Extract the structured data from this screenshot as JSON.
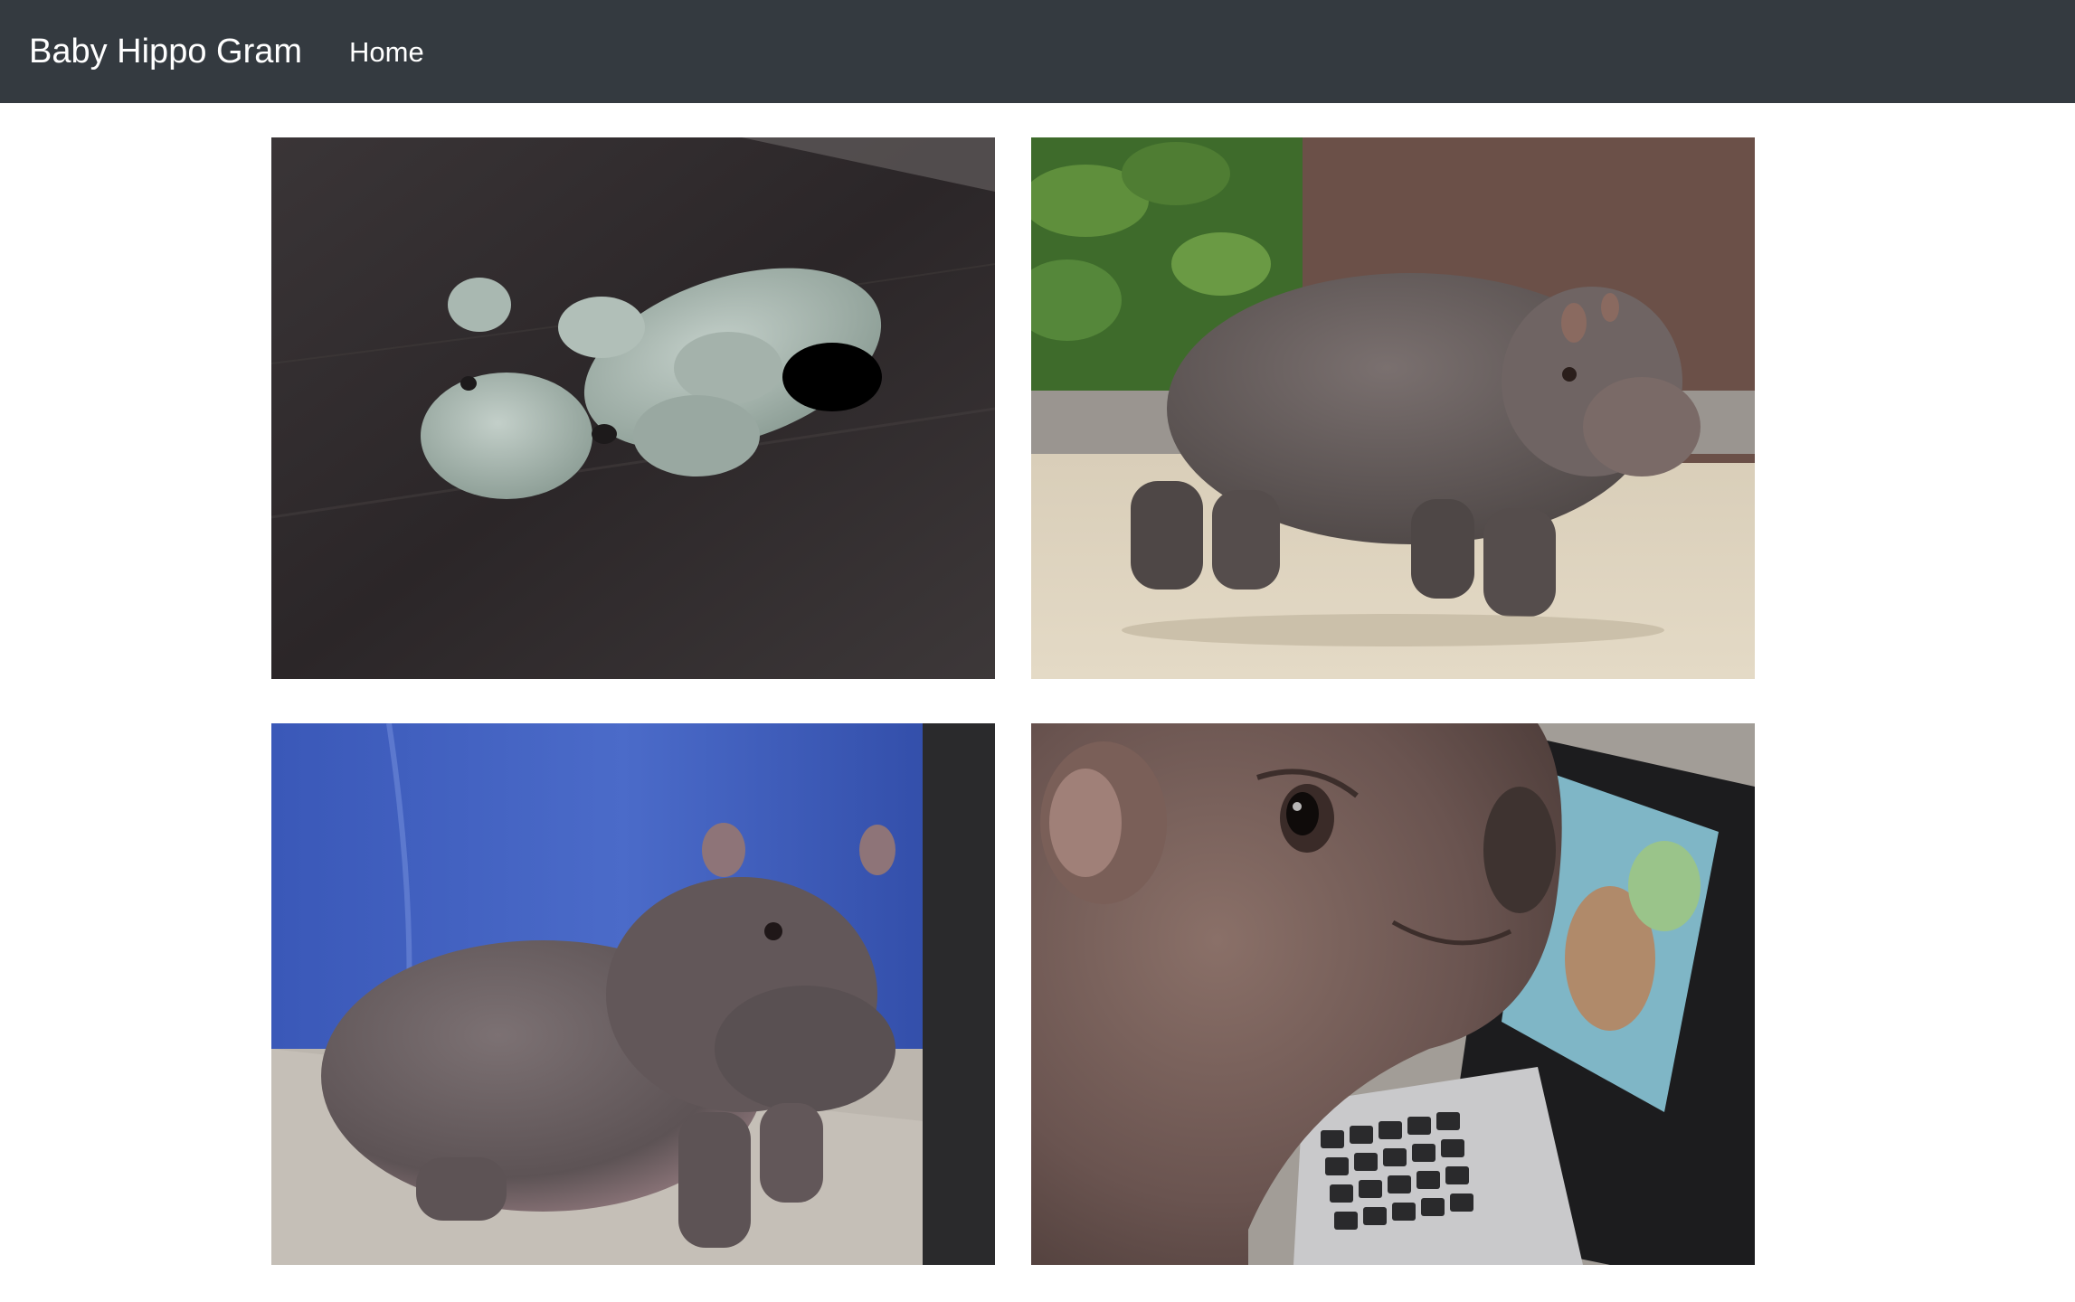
{
  "navbar": {
    "brand": "Baby Hippo Gram",
    "links": [
      {
        "label": "Home"
      }
    ]
  },
  "gallery": {
    "photos": [
      {
        "subject": "crocheted-hippo-toy"
      },
      {
        "subject": "baby-hippo-walking"
      },
      {
        "subject": "baby-hippo-sitting"
      },
      {
        "subject": "baby-hippo-with-tablet"
      }
    ]
  },
  "colors": {
    "navbar_bg": "#343a40",
    "navbar_text": "#ffffff",
    "page_bg": "#ffffff"
  }
}
